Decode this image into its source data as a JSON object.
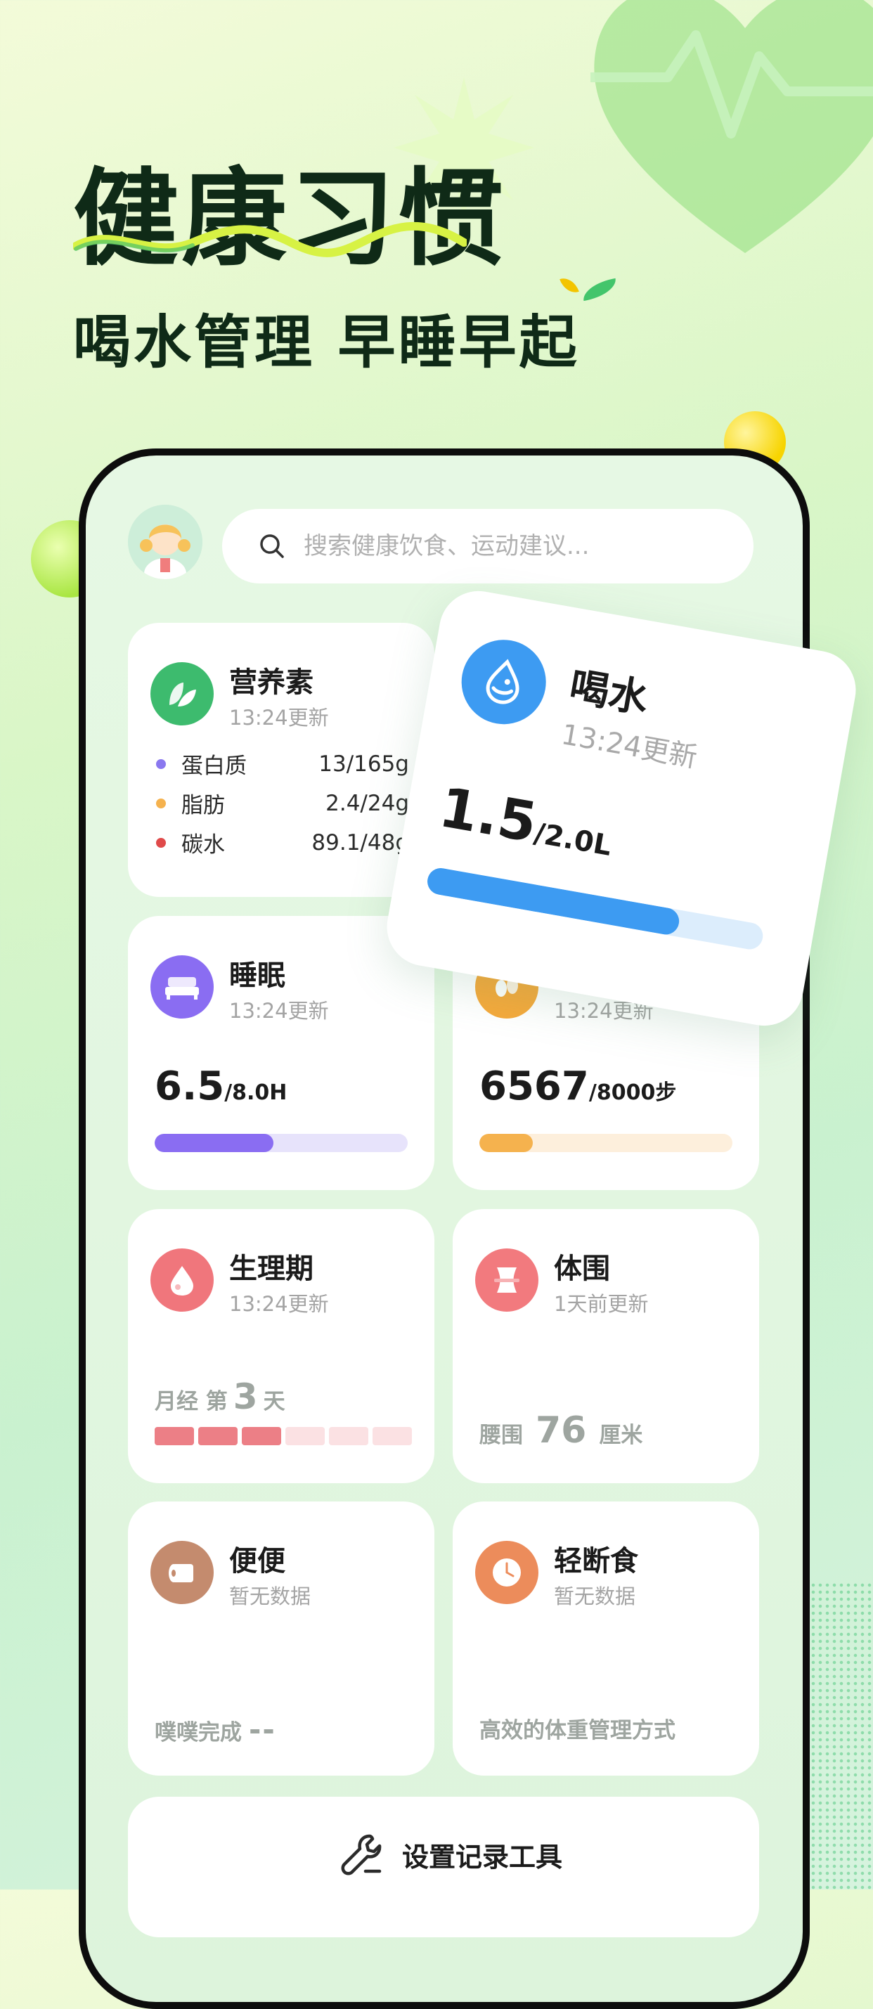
{
  "hero": {
    "title": "健康习惯",
    "subtitle": "喝水管理 早睡早起"
  },
  "search": {
    "placeholder": "搜索健康饮食、运动建议..."
  },
  "cards": {
    "nutrition": {
      "title": "营养素",
      "updated": "13:24更新",
      "rows": [
        {
          "label": "蛋白质",
          "value": "13/165g",
          "color": "#8a78ef"
        },
        {
          "label": "脂肪",
          "value": "2.4/24g",
          "color": "#f5b24e"
        },
        {
          "label": "碳水",
          "value": "89.1/48g",
          "color": "#e04a4a"
        }
      ]
    },
    "water": {
      "title": "喝水",
      "updated": "13:24更新",
      "value": "1.5",
      "unit": "/2.0L",
      "progress": 0.75
    },
    "sleep": {
      "title": "睡眠",
      "updated": "13:24更新",
      "value": "6.5",
      "unit": "/8.0H",
      "progress": 0.47
    },
    "steps": {
      "updated": "13:24更新",
      "value": "6567",
      "unit": "/8000步",
      "progress": 0.21
    },
    "period": {
      "title": "生理期",
      "updated": "13:24更新",
      "prefix": "月经",
      "day_prefix": "第",
      "day": "3",
      "day_suffix": "天",
      "filled_segments": 3,
      "total_segments": 6
    },
    "body": {
      "title": "体围",
      "updated": "1天前更新",
      "label": "腰围",
      "value": "76",
      "unit": "厘米"
    },
    "poop": {
      "title": "便便",
      "updated": "暂无数据",
      "label": "噗噗完成",
      "value": "--"
    },
    "fasting": {
      "title": "轻断食",
      "updated": "暂无数据",
      "desc": "高效的体重管理方式"
    }
  },
  "tools": {
    "label": "设置记录工具"
  },
  "colors": {
    "nutrition_icon": "#3dbb6e",
    "water": "#3d9bf2",
    "sleep": "#8a6df2",
    "steps": "#f5a93b",
    "period": "#f0767c",
    "body": "#f27a7e",
    "poop": "#c48b6e",
    "fasting": "#ec8c5b"
  }
}
